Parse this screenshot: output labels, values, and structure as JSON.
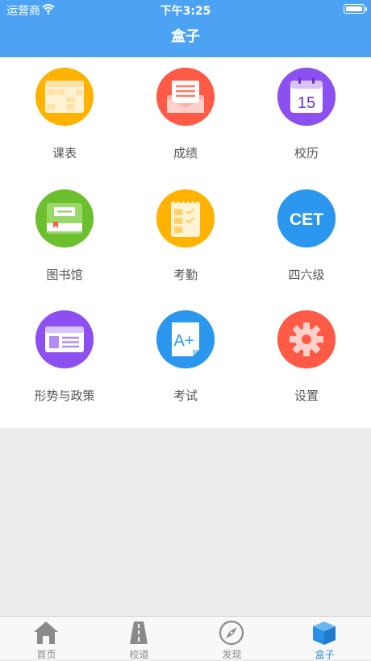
{
  "status_bar": {
    "carrier": "运营商",
    "time": "下午3:25"
  },
  "nav": {
    "title": "盒子"
  },
  "grid": [
    {
      "label": "课表",
      "icon": "timetable-icon",
      "color": "#ffb300"
    },
    {
      "label": "成绩",
      "icon": "grades-envelope-icon",
      "color": "#ff5a45"
    },
    {
      "label": "校历",
      "icon": "calendar-icon",
      "color": "#8d50f0",
      "day": "15"
    },
    {
      "label": "图书馆",
      "icon": "book-icon",
      "color": "#6cbf2e"
    },
    {
      "label": "考勤",
      "icon": "attendance-checklist-icon",
      "color": "#ffb300"
    },
    {
      "label": "四六级",
      "icon": "cet-icon",
      "color": "#2b96ee",
      "text": "CET"
    },
    {
      "label": "形势与政策",
      "icon": "id-card-icon",
      "color": "#8d50f0"
    },
    {
      "label": "考试",
      "icon": "exam-paper-icon",
      "color": "#2b96ee",
      "text": "A+"
    },
    {
      "label": "设置",
      "icon": "gear-icon",
      "color": "#ff5a45"
    }
  ],
  "tabs": [
    {
      "label": "首页",
      "icon": "home-icon",
      "active": false
    },
    {
      "label": "校道",
      "icon": "road-icon",
      "active": false
    },
    {
      "label": "发现",
      "icon": "compass-icon",
      "active": false
    },
    {
      "label": "盒子",
      "icon": "box-icon",
      "active": true
    }
  ],
  "colors": {
    "primary": "#4da3f3",
    "active_tab": "#2b8fe6",
    "inactive_tab": "#8a8a8a"
  }
}
